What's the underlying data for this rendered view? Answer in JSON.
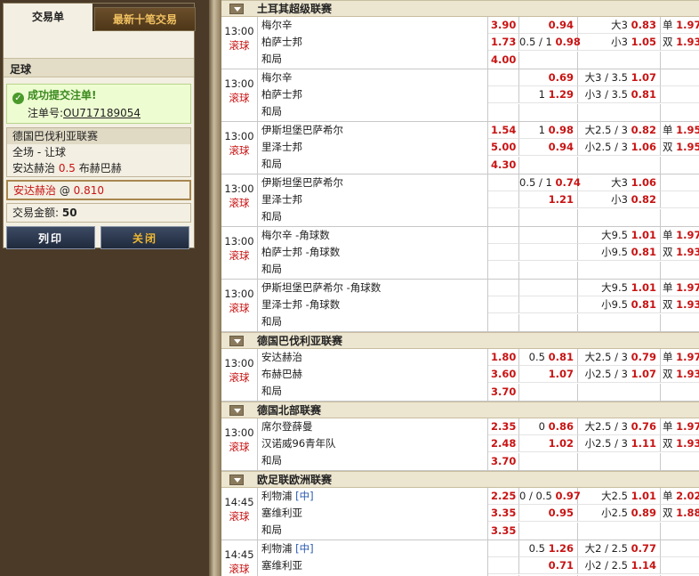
{
  "slip": {
    "tabs": [
      "交易单",
      "最新十笔交易"
    ],
    "sport": "足球",
    "success_msg": "成功提交注单!",
    "order_label": "注单号:",
    "order_no": "OU717189054",
    "league": "德国巴伐利亚联赛",
    "bet_type": "全场 - 让球",
    "home": "安达赫治",
    "handicap": "0.5",
    "away": "布赫巴赫",
    "pick_team": "安达赫治",
    "pick_at": "@",
    "pick_odds": "0.810",
    "amount_label": "交易金额:",
    "amount": "50",
    "print_btn": "列印",
    "close_btn": "关闭"
  },
  "leagues": [
    {
      "name": "土耳其超级联赛",
      "matches": [
        {
          "time": "13:00",
          "live": "滚球",
          "teams": [
            "梅尔辛",
            "柏萨士邦",
            "和局"
          ],
          "odds": [
            [
              "3.90",
              {
                "h": "",
                "o": "0.94"
              },
              {
                "h": "大3",
                "o": "0.83"
              },
              {
                "h": "单",
                "o": "1.97"
              }
            ],
            [
              "1.73",
              {
                "h": "0.5 / 1",
                "o": "0.98"
              },
              {
                "h": "小3",
                "o": "1.05"
              },
              {
                "h": "双",
                "o": "1.93"
              }
            ],
            [
              "4.00",
              {
                "h": "",
                "o": ""
              },
              {
                "h": "",
                "o": ""
              },
              {
                "h": "",
                "o": ""
              }
            ]
          ]
        },
        {
          "time": "13:00",
          "live": "滚球",
          "teams": [
            "梅尔辛",
            "柏萨士邦",
            "和局"
          ],
          "odds": [
            [
              "",
              {
                "h": "",
                "o": "0.69"
              },
              {
                "h": "大3 / 3.5",
                "o": "1.07"
              },
              {
                "h": "",
                "o": ""
              }
            ],
            [
              "",
              {
                "h": "1",
                "o": "1.29"
              },
              {
                "h": "小3 / 3.5",
                "o": "0.81"
              },
              {
                "h": "",
                "o": ""
              }
            ],
            [
              "",
              {
                "h": "",
                "o": ""
              },
              {
                "h": "",
                "o": ""
              },
              {
                "h": "",
                "o": ""
              }
            ]
          ]
        },
        {
          "time": "13:00",
          "live": "滚球",
          "teams": [
            "伊斯坦堡巴萨希尔",
            "里泽士邦",
            "和局"
          ],
          "odds": [
            [
              "1.54",
              {
                "h": "1",
                "o": "0.98"
              },
              {
                "h": "大2.5 / 3",
                "o": "0.82"
              },
              {
                "h": "单",
                "o": "1.95"
              }
            ],
            [
              "5.00",
              {
                "h": "",
                "o": "0.94"
              },
              {
                "h": "小2.5 / 3",
                "o": "1.06"
              },
              {
                "h": "双",
                "o": "1.95"
              }
            ],
            [
              "4.30",
              {
                "h": "",
                "o": ""
              },
              {
                "h": "",
                "o": ""
              },
              {
                "h": "",
                "o": ""
              }
            ]
          ]
        },
        {
          "time": "13:00",
          "live": "滚球",
          "teams": [
            "伊斯坦堡巴萨希尔",
            "里泽士邦",
            "和局"
          ],
          "odds": [
            [
              "",
              {
                "h": "0.5 / 1",
                "o": "0.74"
              },
              {
                "h": "大3",
                "o": "1.06"
              },
              {
                "h": "",
                "o": ""
              }
            ],
            [
              "",
              {
                "h": "",
                "o": "1.21"
              },
              {
                "h": "小3",
                "o": "0.82"
              },
              {
                "h": "",
                "o": ""
              }
            ],
            [
              "",
              {
                "h": "",
                "o": ""
              },
              {
                "h": "",
                "o": ""
              },
              {
                "h": "",
                "o": ""
              }
            ]
          ]
        },
        {
          "time": "13:00",
          "live": "滚球",
          "teams": [
            "梅尔辛 -角球数",
            "柏萨士邦 -角球数",
            "和局"
          ],
          "odds": [
            [
              "",
              {
                "h": "",
                "o": ""
              },
              {
                "h": "大9.5",
                "o": "1.01"
              },
              {
                "h": "单",
                "o": "1.97"
              }
            ],
            [
              "",
              {
                "h": "",
                "o": ""
              },
              {
                "h": "小9.5",
                "o": "0.81"
              },
              {
                "h": "双",
                "o": "1.93"
              }
            ],
            [
              "",
              {
                "h": "",
                "o": ""
              },
              {
                "h": "",
                "o": ""
              },
              {
                "h": "",
                "o": ""
              }
            ]
          ]
        },
        {
          "time": "13:00",
          "live": "滚球",
          "teams": [
            "伊斯坦堡巴萨希尔 -角球数",
            "里泽士邦 -角球数",
            "和局"
          ],
          "odds": [
            [
              "",
              {
                "h": "",
                "o": ""
              },
              {
                "h": "大9.5",
                "o": "1.01"
              },
              {
                "h": "单",
                "o": "1.97"
              }
            ],
            [
              "",
              {
                "h": "",
                "o": ""
              },
              {
                "h": "小9.5",
                "o": "0.81"
              },
              {
                "h": "双",
                "o": "1.93"
              }
            ],
            [
              "",
              {
                "h": "",
                "o": ""
              },
              {
                "h": "",
                "o": ""
              },
              {
                "h": "",
                "o": ""
              }
            ]
          ]
        }
      ]
    },
    {
      "name": "德国巴伐利亚联赛",
      "matches": [
        {
          "time": "13:00",
          "live": "滚球",
          "teams": [
            "安达赫治",
            "布赫巴赫",
            "和局"
          ],
          "odds": [
            [
              "1.80",
              {
                "h": "0.5",
                "o": "0.81"
              },
              {
                "h": "大2.5 / 3",
                "o": "0.79"
              },
              {
                "h": "单",
                "o": "1.97"
              }
            ],
            [
              "3.60",
              {
                "h": "",
                "o": "1.07"
              },
              {
                "h": "小2.5 / 3",
                "o": "1.07"
              },
              {
                "h": "双",
                "o": "1.93"
              }
            ],
            [
              "3.70",
              {
                "h": "",
                "o": ""
              },
              {
                "h": "",
                "o": ""
              },
              {
                "h": "",
                "o": ""
              }
            ]
          ]
        }
      ]
    },
    {
      "name": "德国北部联赛",
      "matches": [
        {
          "time": "13:00",
          "live": "滚球",
          "teams": [
            "席尔登薛曼",
            "汉诺威96青年队",
            "和局"
          ],
          "odds": [
            [
              "2.35",
              {
                "h": "0",
                "o": "0.86"
              },
              {
                "h": "大2.5 / 3",
                "o": "0.76"
              },
              {
                "h": "单",
                "o": "1.97"
              }
            ],
            [
              "2.48",
              {
                "h": "",
                "o": "1.02"
              },
              {
                "h": "小2.5 / 3",
                "o": "1.11"
              },
              {
                "h": "双",
                "o": "1.93"
              }
            ],
            [
              "3.70",
              {
                "h": "",
                "o": ""
              },
              {
                "h": "",
                "o": ""
              },
              {
                "h": "",
                "o": ""
              }
            ]
          ]
        }
      ]
    },
    {
      "name": "欧足联欧洲联赛",
      "matches": [
        {
          "time": "14:45",
          "live": "滚球",
          "teams": [
            "利物浦",
            "塞维利亚",
            "和局"
          ],
          "neutral": "[中]",
          "odds": [
            [
              "2.25",
              {
                "h": "0 / 0.5",
                "o": "0.97"
              },
              {
                "h": "大2.5",
                "o": "1.01"
              },
              {
                "h": "单",
                "o": "2.02"
              }
            ],
            [
              "3.35",
              {
                "h": "",
                "o": "0.95"
              },
              {
                "h": "小2.5",
                "o": "0.89"
              },
              {
                "h": "双",
                "o": "1.88"
              }
            ],
            [
              "3.35",
              {
                "h": "",
                "o": ""
              },
              {
                "h": "",
                "o": ""
              },
              {
                "h": "",
                "o": ""
              }
            ]
          ]
        },
        {
          "time": "14:45",
          "live": "滚球",
          "teams": [
            "利物浦",
            "塞维利亚",
            "和局"
          ],
          "neutral": "[中]",
          "odds": [
            [
              "",
              {
                "h": "0.5",
                "o": "1.26"
              },
              {
                "h": "大2 / 2.5",
                "o": "0.77"
              },
              {
                "h": "",
                "o": ""
              }
            ],
            [
              "",
              {
                "h": "",
                "o": "0.71"
              },
              {
                "h": "小2 / 2.5",
                "o": "1.14"
              },
              {
                "h": "",
                "o": ""
              }
            ],
            [
              "",
              {
                "h": "",
                "o": ""
              },
              {
                "h": "",
                "o": ""
              },
              {
                "h": "",
                "o": ""
              }
            ]
          ]
        }
      ]
    }
  ]
}
